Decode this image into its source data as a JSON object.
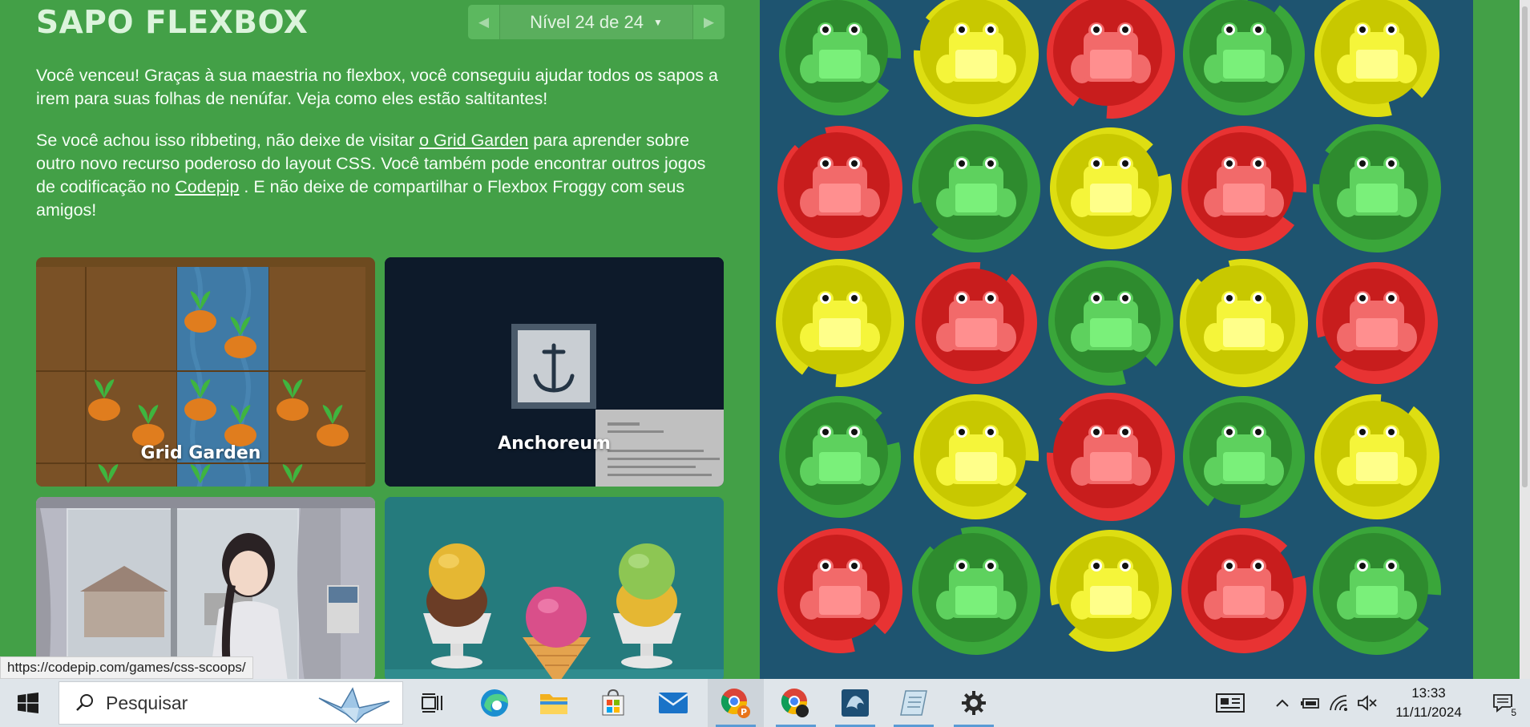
{
  "header": {
    "title": "SAPO FLEXBOX",
    "level_label": "Nível 24 de 24",
    "prev_symbol": "◀",
    "next_symbol": "▶",
    "caret": "▼"
  },
  "content": {
    "para1": "Você venceu! Graças à sua maestria no flexbox, você conseguiu ajudar todos os sapos a irem para suas folhas de nenúfar. Veja como eles estão saltitantes!",
    "para2_a": "Se você achou isso ribbeting, não deixe de visitar ",
    "para2_link1": "o Grid Garden",
    "para2_b": " para aprender sobre outro novo recurso poderoso do layout CSS. Você também pode encontrar outros jogos de codificação no ",
    "para2_link2": "Codepip",
    "para2_c": " . E não deixe de compartilhar o Flexbox Froggy com seus amigos!"
  },
  "games": [
    {
      "label": "Grid Garden"
    },
    {
      "label": "Anchoreum"
    },
    {
      "label": ""
    },
    {
      "label": ""
    }
  ],
  "pond": {
    "rows": [
      [
        "green",
        "yellow",
        "red",
        "green",
        "yellow"
      ],
      [
        "red",
        "green",
        "yellow",
        "red",
        "green"
      ],
      [
        "yellow",
        "red",
        "green",
        "yellow",
        "red"
      ],
      [
        "green",
        "yellow",
        "red",
        "green",
        "yellow"
      ],
      [
        "red",
        "green",
        "yellow",
        "red",
        "green"
      ]
    ],
    "colors": {
      "green": {
        "pad": "#2e8b2e",
        "pad_light": "#3aa63a",
        "frog": "#5ed15e",
        "belly": "#7af07a"
      },
      "yellow": {
        "pad": "#c8c800",
        "pad_light": "#dede12",
        "frog": "#f5f53a",
        "belly": "#ffff8a"
      },
      "red": {
        "pad": "#c81d1d",
        "pad_light": "#e83333",
        "frog": "#f26a6a",
        "belly": "#ff8f8f"
      }
    }
  },
  "status_url": "https://codepip.com/games/css-scoops/",
  "taskbar": {
    "search_placeholder": "Pesquisar",
    "time": "13:33",
    "date": "11/11/2024",
    "notification_count": "5"
  }
}
